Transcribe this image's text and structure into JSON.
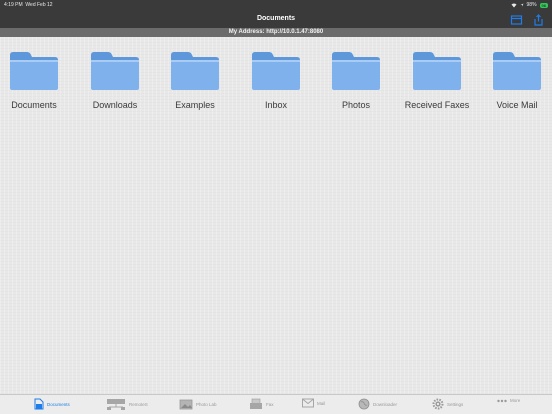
{
  "status": {
    "time": "4:19 PM",
    "date": "Wed Feb 12",
    "battery": "98%"
  },
  "nav": {
    "title": "Documents",
    "left_button_icon": "browser-icon",
    "right_button_icon": "share-icon"
  },
  "address": "My Address: http://10.0.1.47:8080",
  "folders": [
    {
      "label": "Documents"
    },
    {
      "label": "Downloads"
    },
    {
      "label": "Examples"
    },
    {
      "label": "Inbox"
    },
    {
      "label": "Photos"
    },
    {
      "label": "Received Faxes"
    },
    {
      "label": "Voice Mail"
    }
  ],
  "tabs": [
    {
      "label": "Documents",
      "icon": "documents-icon",
      "active": true
    },
    {
      "label": "RemoteS",
      "icon": "network-icon"
    },
    {
      "label": "Photo Lab",
      "icon": "photo-icon"
    },
    {
      "label": "Fax",
      "icon": "fax-icon"
    },
    {
      "label": "Mail",
      "icon": "mail-icon"
    },
    {
      "label": "Downloader",
      "icon": "globe-icon"
    },
    {
      "label": "Settings",
      "icon": "gear-icon"
    },
    {
      "label": "More",
      "icon": "more-icon"
    }
  ],
  "colors": {
    "accent": "#1e7de8",
    "bar": "#3a3a3a",
    "address_bar": "#6b6b6b",
    "folder": "#7fb2ec"
  }
}
